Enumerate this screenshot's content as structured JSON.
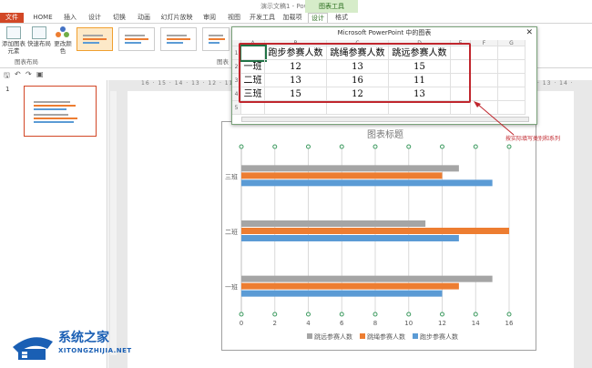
{
  "window": {
    "title": "演示文稿1 - PowerPoint",
    "context_header": "图表工具"
  },
  "tabs": [
    {
      "label": "文件"
    },
    {
      "label": "HOME"
    },
    {
      "label": "插入"
    },
    {
      "label": "设计"
    },
    {
      "label": "切换"
    },
    {
      "label": "动画"
    },
    {
      "label": "幻灯片放映"
    },
    {
      "label": "审阅"
    },
    {
      "label": "视图"
    },
    {
      "label": "开发工具"
    },
    {
      "label": "加载项"
    },
    {
      "label": "设计"
    },
    {
      "label": "格式"
    }
  ],
  "ribbon": {
    "add_element": "添加图表元素",
    "quick_layout": "快速布局",
    "change_colors": "更改颜色",
    "group_layout": "图表布局",
    "group_styles": "图表"
  },
  "excel": {
    "title": "Microsoft PowerPoint 中的图表",
    "col_headers": [
      "A",
      "B",
      "C",
      "D",
      "E",
      "F",
      "G"
    ],
    "row_numbers": [
      "1",
      "2",
      "3",
      "4",
      "5"
    ],
    "header_row": [
      "",
      "跑步参赛人数",
      "跳绳参赛人数",
      "跳远参赛人数"
    ],
    "rows": [
      [
        "一班",
        "12",
        "13",
        "15"
      ],
      [
        "二班",
        "13",
        "16",
        "11"
      ],
      [
        "三班",
        "15",
        "12",
        "13"
      ]
    ]
  },
  "annotation": "按实际填写类别和系列",
  "ruler_text": "16 · 15 · 14 · 13 · 12 · 11 · 10 · 9 · 8 · 7 · 6 · 5 · 4 · 3 · 2 · 1 · 0 · 1 · 2 · 3 · 4 · 5 · 6 · 7 · 8 · 9 · 10 · 11 · 12 · 13 · 14 · 15 · 16",
  "slide_panel": {
    "slide_number": "1"
  },
  "watermark": {
    "text": "系统之家",
    "sub": "XITONGZHIJIA.NET"
  },
  "chart_data": {
    "type": "bar",
    "orientation": "horizontal",
    "title": "图表标题",
    "categories": [
      "一班",
      "二班",
      "三班"
    ],
    "series": [
      {
        "name": "跑步参赛人数",
        "values": [
          12,
          13,
          15
        ],
        "color": "#5b9bd5"
      },
      {
        "name": "跳绳参赛人数",
        "values": [
          13,
          16,
          12
        ],
        "color": "#ed7d31"
      },
      {
        "name": "跳远参赛人数",
        "values": [
          15,
          11,
          13
        ],
        "color": "#a5a5a5"
      }
    ],
    "xlim": [
      0,
      16
    ],
    "xticks": [
      0,
      2,
      4,
      6,
      8,
      10,
      12,
      14,
      16
    ],
    "grid": true,
    "legend": "bottom"
  }
}
